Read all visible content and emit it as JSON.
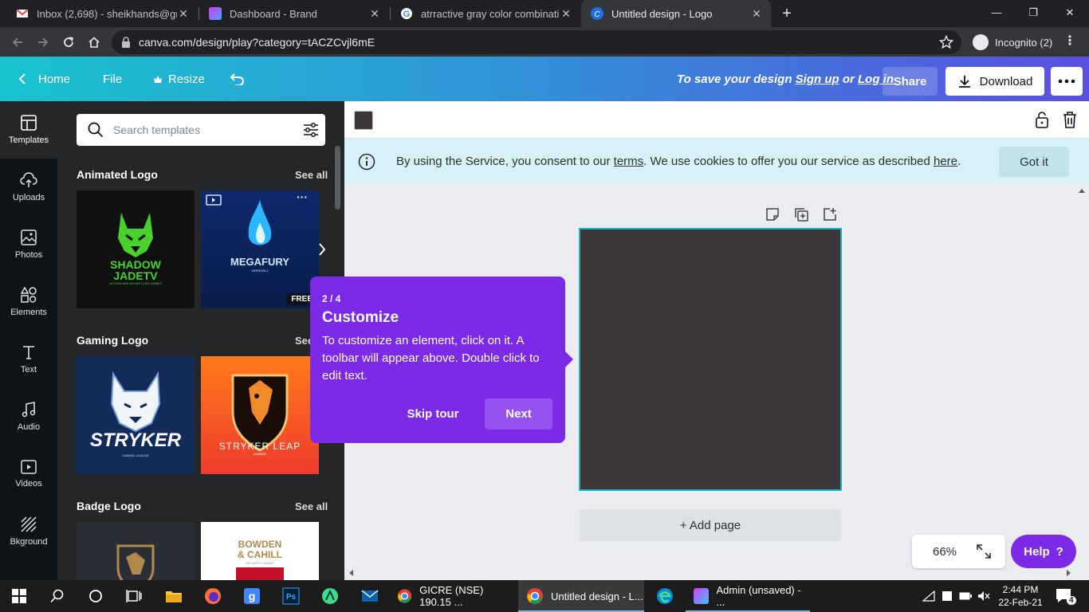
{
  "browser": {
    "tabs": [
      {
        "title": "Inbox (2,698) - sheikhands@gma",
        "favicon_color": "#ea4335"
      },
      {
        "title": "Dashboard - Brand",
        "favicon_color": "#8e44ad"
      },
      {
        "title": "atrractive gray color combination",
        "favicon_color": "#4285f4"
      },
      {
        "title": "Untitled design - Logo",
        "favicon_color": "#1f6feb"
      }
    ],
    "active_tab": 3,
    "url": "canva.com/design/play?category=tACZCvjl6mE",
    "incognito_label": "Incognito (2)"
  },
  "header": {
    "home_label": "Home",
    "file_label": "File",
    "resize_label": "Resize",
    "save_prefix": "To save your design",
    "signup_label": "Sign up",
    "or_label": "or",
    "login_label": "Log in",
    "share_label": "Share",
    "download_label": "Download"
  },
  "rail": {
    "items": [
      {
        "label": "Templates",
        "icon": "templates-icon"
      },
      {
        "label": "Uploads",
        "icon": "uploads-icon"
      },
      {
        "label": "Photos",
        "icon": "photos-icon"
      },
      {
        "label": "Elements",
        "icon": "elements-icon"
      },
      {
        "label": "Text",
        "icon": "text-icon"
      },
      {
        "label": "Audio",
        "icon": "audio-icon"
      },
      {
        "label": "Videos",
        "icon": "videos-icon"
      },
      {
        "label": "Bkground",
        "icon": "background-icon"
      }
    ]
  },
  "panel": {
    "search_placeholder": "Search templates",
    "sections": [
      {
        "title": "Animated Logo",
        "see_all": "See all",
        "thumbs": [
          {
            "line1": "SHADOW",
            "line2": "JADETV",
            "tagline": "ACTION AND ADVENTURE GAMES"
          },
          {
            "line1": "MEGAFURY",
            "tagline": "VERSION 2",
            "badge": "FREE"
          }
        ]
      },
      {
        "title": "Gaming Logo",
        "see_all": "See",
        "thumbs": [
          {
            "line1": "STRYKER",
            "tagline": "GAMING LEAGUE"
          },
          {
            "line1": "STRYKER LEAP",
            "tagline": "GAMING"
          }
        ]
      },
      {
        "title": "Badge Logo",
        "see_all": "See all",
        "thumbs": [
          {
            "line1": ""
          },
          {
            "line1": "BOWDEN",
            "line2": "& CAHILL",
            "tagline": "SECURITY GROUP"
          }
        ]
      }
    ]
  },
  "editor": {
    "cookie_pre": "By using the Service, you consent to our",
    "cookie_terms": "terms",
    "cookie_mid": ". We use cookies to offer you our service as described",
    "cookie_here": "here",
    "cookie_end": ".",
    "got_it": "Got it",
    "canvas_color": "#3e3838",
    "add_page": "+ Add page",
    "zoom": "66%",
    "help_label": "Help",
    "help_mark": "?"
  },
  "tour": {
    "step": "2 / 4",
    "title": "Customize",
    "body": "To customize an element, click on it. A toolbar will appear above. Double click to edit text.",
    "skip": "Skip tour",
    "next": "Next"
  },
  "taskbar": {
    "apps": [
      {
        "label": "GICRE (NSE) 190.15 ..."
      },
      {
        "label": "Untitled design - L..."
      },
      {
        "label": "Admin (unsaved) - ..."
      }
    ],
    "time": "2:44 PM",
    "date": "22-Feb-21",
    "notifications": "4"
  }
}
